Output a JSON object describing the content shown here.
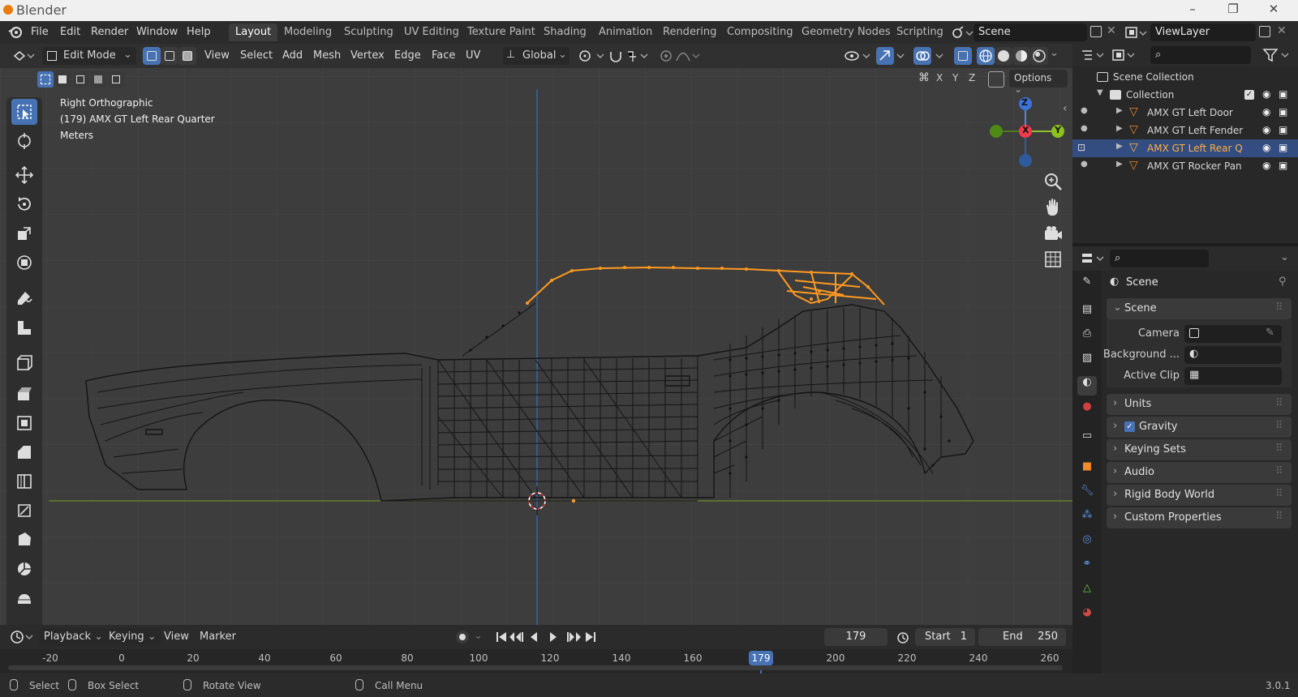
{
  "window": {
    "title": "Blender",
    "version": "3.0.1"
  },
  "menu": [
    "File",
    "Edit",
    "Render",
    "Window",
    "Help"
  ],
  "workspaces": [
    "Layout",
    "Modeling",
    "Sculpting",
    "UV Editing",
    "Texture Paint",
    "Shading",
    "Animation",
    "Rendering",
    "Compositing",
    "Geometry Nodes",
    "Scripting"
  ],
  "active_workspace": "Layout",
  "scene_name": "Scene",
  "view_layer": "ViewLayer",
  "header": {
    "mode": "Edit Mode",
    "menus": [
      "View",
      "Select",
      "Add",
      "Mesh",
      "Vertex",
      "Edge",
      "Face",
      "UV"
    ],
    "transform_orientation": "Global",
    "options": "Options",
    "axes": [
      "X",
      "Y",
      "Z"
    ]
  },
  "viewport": {
    "view_name": "Right Orthographic",
    "object_info": "(179) AMX GT Left Rear Quarter",
    "units": "Meters",
    "gizmo_axes": {
      "z": "Z",
      "x": "X",
      "y": "Y"
    }
  },
  "outliner": {
    "root": "Scene Collection",
    "collection": "Collection",
    "items": [
      {
        "name": "AMX GT Left Door",
        "selected": false
      },
      {
        "name": "AMX GT Left Fender",
        "selected": false
      },
      {
        "name": "AMX GT Left Rear Q",
        "selected": true
      },
      {
        "name": "AMX GT Rocker Pan",
        "selected": false
      }
    ]
  },
  "properties": {
    "context": "Scene",
    "panel": "Scene",
    "fields": [
      {
        "label": "Camera"
      },
      {
        "label": "Background ..."
      },
      {
        "label": "Active Clip"
      }
    ],
    "sections": [
      {
        "label": "Units",
        "checkbox": false
      },
      {
        "label": "Gravity",
        "checkbox": true
      },
      {
        "label": "Keying Sets",
        "checkbox": false
      },
      {
        "label": "Audio",
        "checkbox": false
      },
      {
        "label": "Rigid Body World",
        "checkbox": false
      },
      {
        "label": "Custom Properties",
        "checkbox": false
      }
    ]
  },
  "timeline": {
    "menus": [
      "Playback",
      "Keying",
      "View",
      "Marker"
    ],
    "current_frame": "179",
    "start_label": "Start",
    "start": "1",
    "end_label": "End",
    "end": "250",
    "ticks": [
      "-20",
      "0",
      "20",
      "40",
      "60",
      "80",
      "100",
      "120",
      "140",
      "160",
      "179",
      "200",
      "220",
      "240",
      "260"
    ]
  },
  "status": {
    "select": "Select",
    "box_select": "Box Select",
    "rotate_view": "Rotate View",
    "call_menu": "Call Menu"
  },
  "colors": {
    "accent": "#4772b3",
    "selection": "#ff9a1f",
    "viewport_bg": "#3d3d3d"
  }
}
